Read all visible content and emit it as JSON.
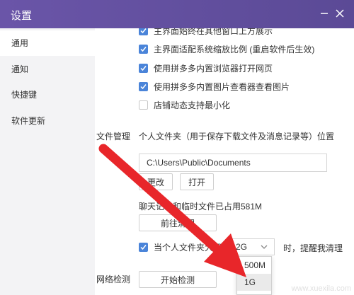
{
  "window": {
    "title": "设置"
  },
  "sidebar": {
    "items": [
      {
        "label": "通用",
        "active": true
      },
      {
        "label": "通知",
        "active": false
      },
      {
        "label": "快捷键",
        "active": false
      },
      {
        "label": "软件更新",
        "active": false
      }
    ]
  },
  "general": {
    "checkboxes": [
      {
        "label": "主界面始终在其他窗口上方展示",
        "checked": true
      },
      {
        "label": "主界面适配系统缩放比例 (重启软件后生效)",
        "checked": true
      },
      {
        "label": "使用拼多多内置浏览器打开网页",
        "checked": true
      },
      {
        "label": "使用拼多多内置图片查看器查看图片",
        "checked": true
      },
      {
        "label": "店铺动态支持最小化",
        "checked": false
      }
    ]
  },
  "file_management": {
    "section_label": "文件管理",
    "description": "个人文件夹（用于保存下载文件及消息记录等）位置",
    "path_value": "C:\\Users\\Public\\Documents",
    "change_button": "更改",
    "open_button": "打开",
    "usage_text": "聊天记录和临时文件已占用581M",
    "goto_clean_button": "前往清理",
    "limit_checkbox_checked": true,
    "limit_prefix": "当个人文件夹大于",
    "limit_selected": "2G",
    "limit_suffix": "时，提醒我清理",
    "limit_options": [
      "500M",
      "1G"
    ]
  },
  "network": {
    "section_label": "网络检测",
    "start_button": "开始检测"
  },
  "watermark": {
    "text": "www.xuexila.com"
  },
  "colors": {
    "titlebar": "#5b4a96",
    "checkbox_accent": "#4a84d9",
    "annotation_arrow": "#e8262a",
    "sidebar_bg": "#f3f3f5"
  },
  "icons": {
    "minimize": "minimize-icon",
    "close": "close-icon",
    "checkmark": "checkmark-icon",
    "dropdown": "chevron-down-icon",
    "arrow": "annotation-arrow"
  }
}
